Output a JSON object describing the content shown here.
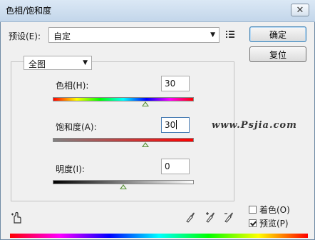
{
  "window": {
    "title": "色相/饱和度",
    "close_label": "✕"
  },
  "preset": {
    "label": "预设(E):",
    "value": "自定"
  },
  "buttons": {
    "ok": "确定",
    "reset": "复位"
  },
  "channel": {
    "value": "全图"
  },
  "sliders": {
    "hue": {
      "label": "色相(H):",
      "value": "30",
      "level_fraction": 0.66
    },
    "saturation": {
      "label": "饱和度(A):",
      "value": "30",
      "level_fraction": 0.66
    },
    "lightness": {
      "label": "明度(I):",
      "value": "0",
      "level_fraction": 0.5
    }
  },
  "watermark": "www.Psjia.com",
  "options": {
    "colorize": {
      "label": "着色(O)",
      "checked": false
    },
    "preview": {
      "label": "预览(P)",
      "checked": true
    }
  },
  "icons": {
    "menu": "list-menu-icon",
    "target_adjust": "hand-target-icon",
    "droppers": [
      "eyedropper-icon",
      "eyedropper-plus-icon",
      "eyedropper-minus-icon"
    ]
  }
}
